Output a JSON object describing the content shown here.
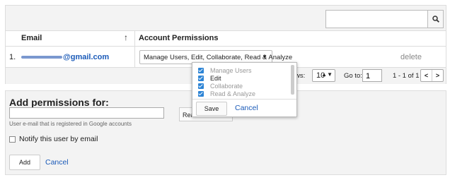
{
  "table": {
    "col_email": "Email",
    "col_permissions": "Account Permissions",
    "sort_icon": "arrow-up-icon",
    "row": {
      "number": "1.",
      "email_visible": "@gmail.com",
      "permissions_value": "Manage Users, Edit, Collaborate, Read & Analyze",
      "delete_label": "delete"
    }
  },
  "search": {
    "placeholder": "",
    "icon": "search-icon"
  },
  "pager": {
    "rows_label": "ws:",
    "rows_value": "10",
    "goto_label": "Go to:",
    "goto_value": "1",
    "count_text": "1 - 1 of 1"
  },
  "popup": {
    "options": [
      {
        "label": "Manage Users",
        "checked": true,
        "dim": true
      },
      {
        "label": "Edit",
        "checked": true,
        "dim": false
      },
      {
        "label": "Collaborate",
        "checked": true,
        "dim": true
      },
      {
        "label": "Read & Analyze",
        "checked": true,
        "dim": true
      }
    ],
    "save_label": "Save",
    "cancel_label": "Cancel"
  },
  "add": {
    "title": "Add permissions for:",
    "email_value": "",
    "roles_button_visible": "Rea",
    "hint": "User e-mail that is registered in Google accounts",
    "notify_label": "Notify this user by email",
    "add_label": "Add",
    "cancel_label": "Cancel"
  },
  "colors": {
    "accent": "#2d84d5",
    "link": "#1a5ab8"
  }
}
